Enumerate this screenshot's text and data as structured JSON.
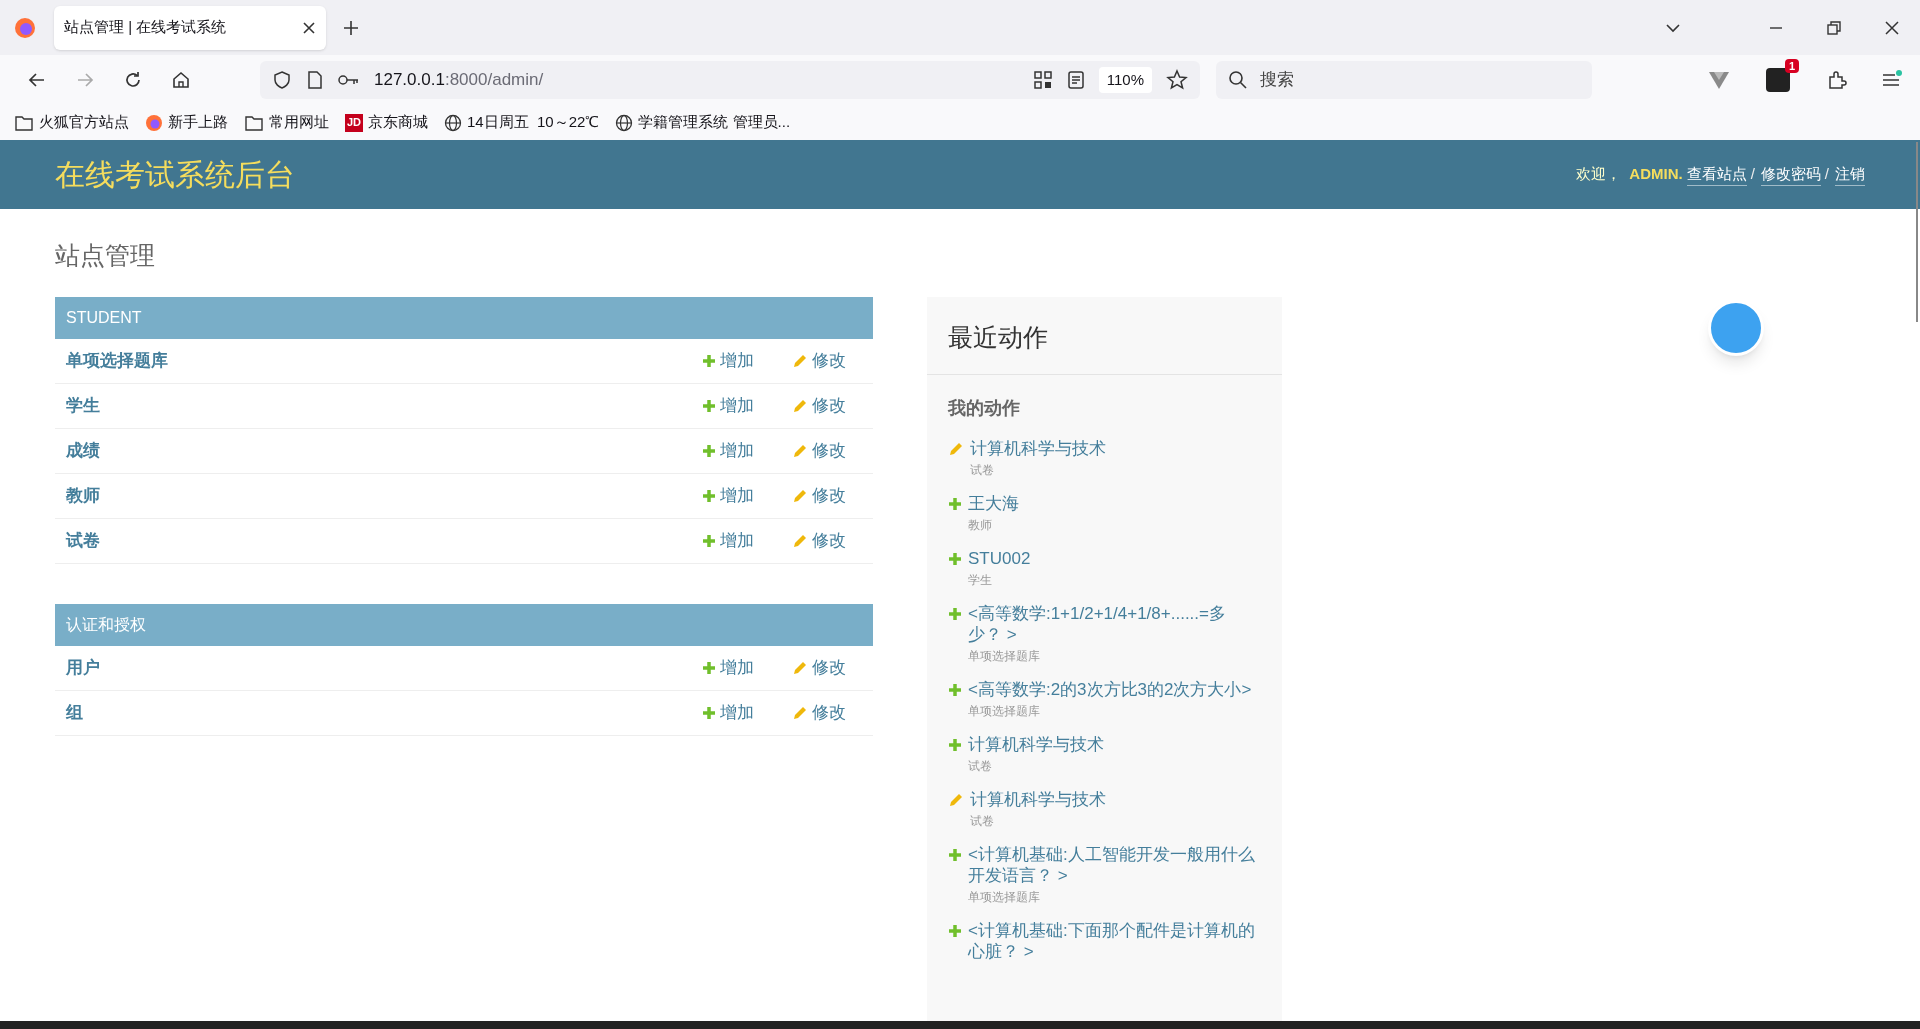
{
  "browser": {
    "tab": {
      "title": "站点管理 | 在线考试系统",
      "selected": true
    },
    "url": {
      "host": "127.0.0.1",
      "rest": ":8000/admin/"
    },
    "zoom": "110%",
    "search": {
      "placeholder": "搜索"
    },
    "extension_badge": "1",
    "bookmarks": [
      {
        "kind": "folder",
        "label": "火狐官方站点"
      },
      {
        "kind": "firefox",
        "label": "新手上路"
      },
      {
        "kind": "folder",
        "label": "常用网址"
      },
      {
        "kind": "jd",
        "label": "京东商城",
        "icon_text": "JD"
      },
      {
        "kind": "globe",
        "label": "14日周五  10～22℃"
      },
      {
        "kind": "globe",
        "label": "学籍管理系统 管理员..."
      }
    ]
  },
  "header": {
    "brand": "在线考试系统后台",
    "welcome": "欢迎，",
    "user": "ADMIN.",
    "links": [
      "查看站点",
      "修改密码",
      "注销"
    ],
    "separator": "/"
  },
  "page_title": "站点管理",
  "modules": [
    {
      "caption": "STUDENT",
      "rows": [
        {
          "name": "单项选择题库",
          "add": "增加",
          "change": "修改"
        },
        {
          "name": "学生",
          "add": "增加",
          "change": "修改"
        },
        {
          "name": "成绩",
          "add": "增加",
          "change": "修改"
        },
        {
          "name": "教师",
          "add": "增加",
          "change": "修改"
        },
        {
          "name": "试卷",
          "add": "增加",
          "change": "修改"
        }
      ]
    },
    {
      "caption": "认证和授权",
      "rows": [
        {
          "name": "用户",
          "add": "增加",
          "change": "修改"
        },
        {
          "name": "组",
          "add": "增加",
          "change": "修改"
        }
      ]
    }
  ],
  "recent_actions": {
    "title": "最近动作",
    "subtitle": "我的动作",
    "items": [
      {
        "kind": "change",
        "label": "计算机科学与技术",
        "type": "试卷"
      },
      {
        "kind": "add",
        "label": "王大海",
        "type": "教师"
      },
      {
        "kind": "add",
        "label": "STU002",
        "type": "学生"
      },
      {
        "kind": "add",
        "label": "<高等数学:1+1/2+1/4+1/8+......=多少？ >",
        "type": "单项选择题库"
      },
      {
        "kind": "add",
        "label": "<高等数学:2的3次方比3的2次方大小>",
        "type": "单项选择题库"
      },
      {
        "kind": "add",
        "label": "计算机科学与技术",
        "type": "试卷"
      },
      {
        "kind": "change",
        "label": "计算机科学与技术",
        "type": "试卷"
      },
      {
        "kind": "add",
        "label": "<计算机基础:人工智能开发一般用什么开发语言？ >",
        "type": "单项选择题库"
      },
      {
        "kind": "add",
        "label": "<计算机基础:下面那个配件是计算机的心脏？ >"
      }
    ]
  }
}
